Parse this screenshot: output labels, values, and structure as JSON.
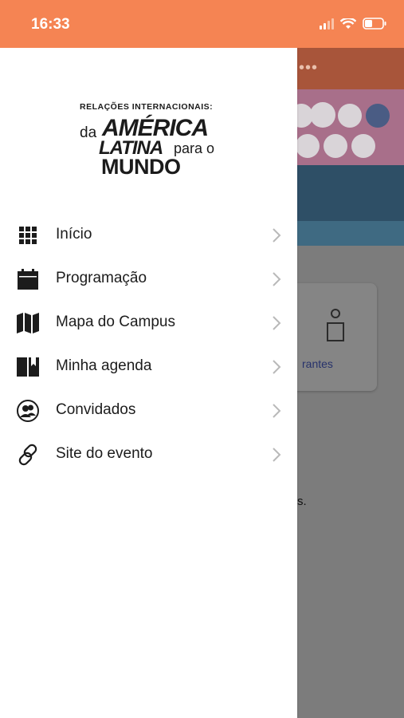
{
  "status_bar": {
    "time": "16:33",
    "icons": [
      "signal-icon",
      "wifi-icon",
      "battery-icon"
    ]
  },
  "brand": {
    "line1": "RELAÇÕES INTERNACIONAIS:",
    "da": "da",
    "america": "AMÉRICA",
    "latina": "LATINA",
    "para_o": "para o",
    "mundo": "MUNDO"
  },
  "menu": {
    "items": [
      {
        "label": "Início",
        "icon": "grid-icon"
      },
      {
        "label": "Programação",
        "icon": "calendar-icon"
      },
      {
        "label": "Mapa do Campus",
        "icon": "map-icon"
      },
      {
        "label": "Minha agenda",
        "icon": "book-icon"
      },
      {
        "label": "Convidados",
        "icon": "users-icon"
      },
      {
        "label": "Site do evento",
        "icon": "link-icon"
      }
    ]
  },
  "background": {
    "header_dots": "•••",
    "card_label": "rantes",
    "trailing_text": "s."
  },
  "colors": {
    "status_bar": "#f58453",
    "drawer": "#ffffff",
    "text": "#1c1c1c",
    "chevron": "#b9b9b9"
  }
}
